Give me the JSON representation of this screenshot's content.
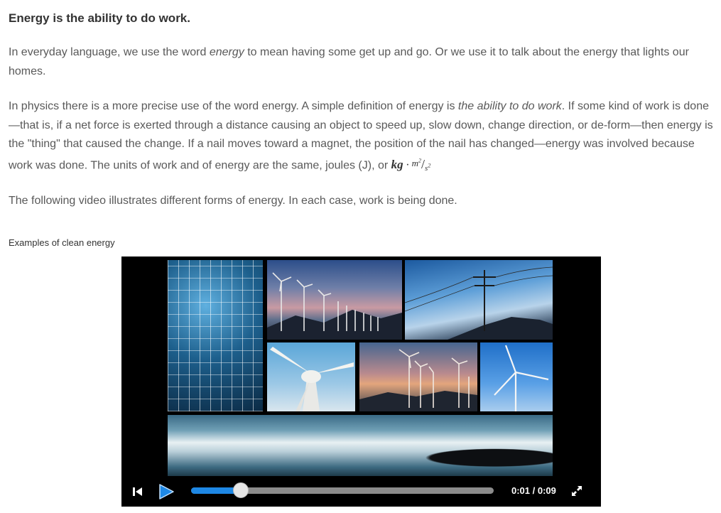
{
  "article": {
    "heading": "Energy is the ability to do work.",
    "p1": {
      "before": "In everyday language, we use the word ",
      "em": "energy",
      "after": " to mean having some get up and go. Or we use it to talk about the energy that lights our homes."
    },
    "p2": {
      "before": "In physics there is a more precise use of the word energy. A simple definition of energy is ",
      "em": "the ability to do work",
      "after": ". If some kind of work is done—that is, if a net force is exerted through a distance causing an object to speed up, slow down, change direction, or de-form—then energy is the \"thing\" that caused the change. If a nail moves toward a magnet, the position of the nail has changed—energy was involved because work was done. The units of work and of energy are the same, joules (J), or ",
      "unit_kg": "kg",
      "unit_dot": "·",
      "unit_num": "m",
      "unit_num_exp": "2",
      "unit_slash": "/",
      "unit_den": "s",
      "unit_den_exp": "2"
    },
    "p3": "The following video illustrates different forms of energy. In each case, work is being done."
  },
  "video": {
    "caption": "Examples of clean energy",
    "time_display": "0:01 / 0:09",
    "progress_fraction": 0.165,
    "icons": {
      "skip_back": "skip-back-icon",
      "play": "play-icon",
      "fullscreen": "fullscreen-icon"
    },
    "colors": {
      "progress": "#1e88e5",
      "play_button": "#1e88e5",
      "player_bg": "#000000"
    }
  }
}
